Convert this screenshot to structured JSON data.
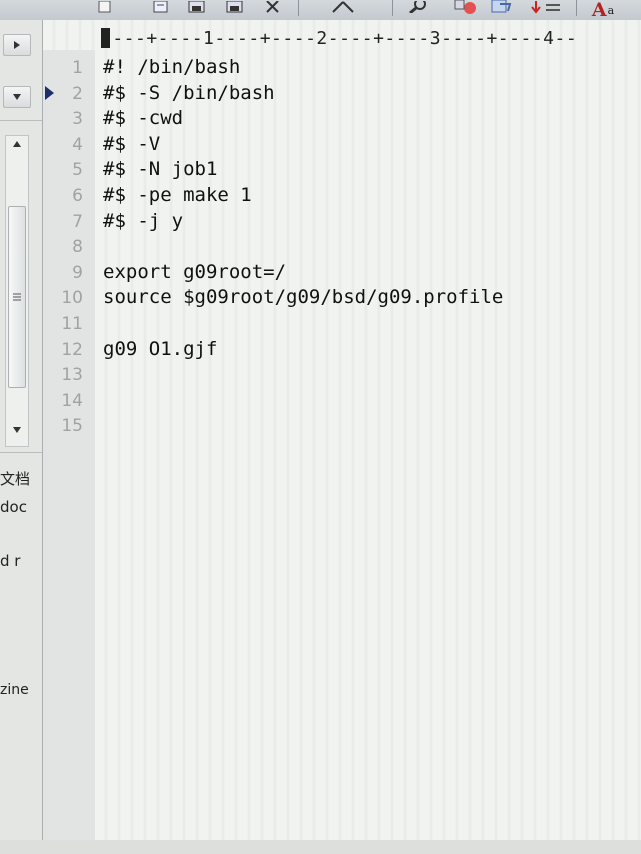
{
  "ruler": {
    "text": "----+----1----+----2----+----3----+----4--"
  },
  "editor": {
    "lines": [
      {
        "num": "1",
        "text": "#! /bin/bash"
      },
      {
        "num": "2",
        "text": "#$ -S /bin/bash"
      },
      {
        "num": "3",
        "text": "#$ -cwd"
      },
      {
        "num": "4",
        "text": "#$ -V"
      },
      {
        "num": "5",
        "text": "#$ -N job1"
      },
      {
        "num": "6",
        "text": "#$ -pe make 1"
      },
      {
        "num": "7",
        "text": "#$ -j y"
      },
      {
        "num": "8",
        "text": ""
      },
      {
        "num": "9",
        "text": "export g09root=/"
      },
      {
        "num": "10",
        "text": "source $g09root/g09/bsd/g09.profile"
      },
      {
        "num": "11",
        "text": ""
      },
      {
        "num": "12",
        "text": "g09 O1.gjf"
      },
      {
        "num": "13",
        "text": ""
      },
      {
        "num": "14",
        "text": ""
      },
      {
        "num": "15",
        "text": ""
      }
    ]
  },
  "left_panel": {
    "fragments": [
      "文档",
      "doc",
      "d r",
      "zine"
    ]
  },
  "toolbar": {
    "font_button_label": "A"
  },
  "icons": {
    "expand": "triangle-right-icon",
    "dropdown": "triangle-down-icon",
    "scroll_up": "triangle-up-icon",
    "scroll_down": "triangle-down-icon",
    "grip": "grip-icon",
    "marker": "current-line-marker-icon"
  },
  "colors": {
    "marker": "#1b2f6b",
    "line_numbers": "#9fa3a4",
    "code_text": "#101010"
  }
}
